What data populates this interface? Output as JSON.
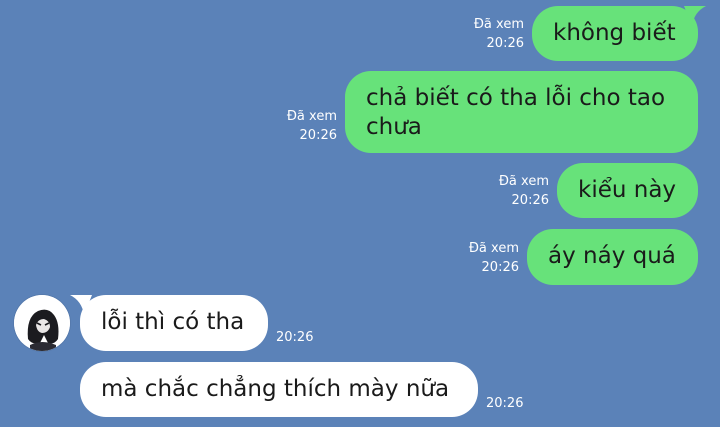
{
  "messages": [
    {
      "text": "không biết",
      "seen": "Đã xem",
      "time": "20:26"
    },
    {
      "text": "chả biết có tha lỗi cho tao chưa",
      "seen": "Đã xem",
      "time": "20:26"
    },
    {
      "text": "kiểu này",
      "seen": "Đã xem",
      "time": "20:26"
    },
    {
      "text": "áy náy quá",
      "seen": "Đã xem",
      "time": "20:26"
    },
    {
      "text": "lỗi thì có tha",
      "time": "20:26"
    },
    {
      "text": "mà chắc chẳng thích mày nữa",
      "time": "20:26"
    }
  ],
  "colors": {
    "background": "#5b82b8",
    "outgoing_bubble": "#67e27a",
    "incoming_bubble": "#ffffff"
  },
  "icons": {
    "contact_avatar": "avatar-icon"
  }
}
